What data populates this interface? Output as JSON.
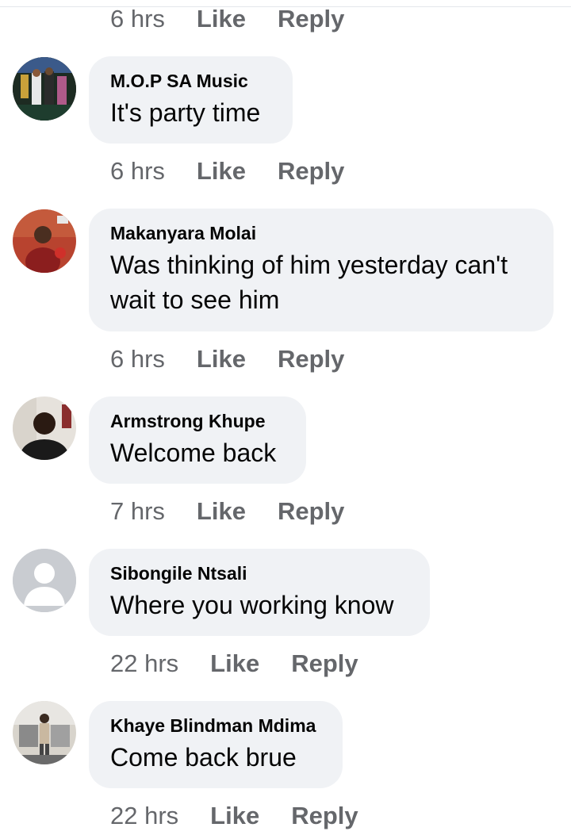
{
  "top_meta": {
    "time": "6 hrs",
    "like": "Like",
    "reply": "Reply"
  },
  "comments": [
    {
      "author": "M.O.P SA Music",
      "text": "It's party time",
      "time": "6 hrs",
      "like": "Like",
      "reply": "Reply"
    },
    {
      "author": "Makanyara Molai",
      "text": "Was thinking of him yesterday can't wait to see him",
      "time": "6 hrs",
      "like": "Like",
      "reply": "Reply"
    },
    {
      "author": "Armstrong Khupe",
      "text": "Welcome back",
      "time": "7 hrs",
      "like": "Like",
      "reply": "Reply"
    },
    {
      "author": "Sibongile Ntsali",
      "text": "Where you working know",
      "time": "22 hrs",
      "like": "Like",
      "reply": "Reply"
    },
    {
      "author": "Khaye Blindman Mdima",
      "text": "Come back brue",
      "time": "22 hrs",
      "like": "Like",
      "reply": "Reply"
    }
  ],
  "colors": {
    "bubble": "#f0f2f5",
    "meta_text": "#65676b",
    "text": "#050505"
  }
}
